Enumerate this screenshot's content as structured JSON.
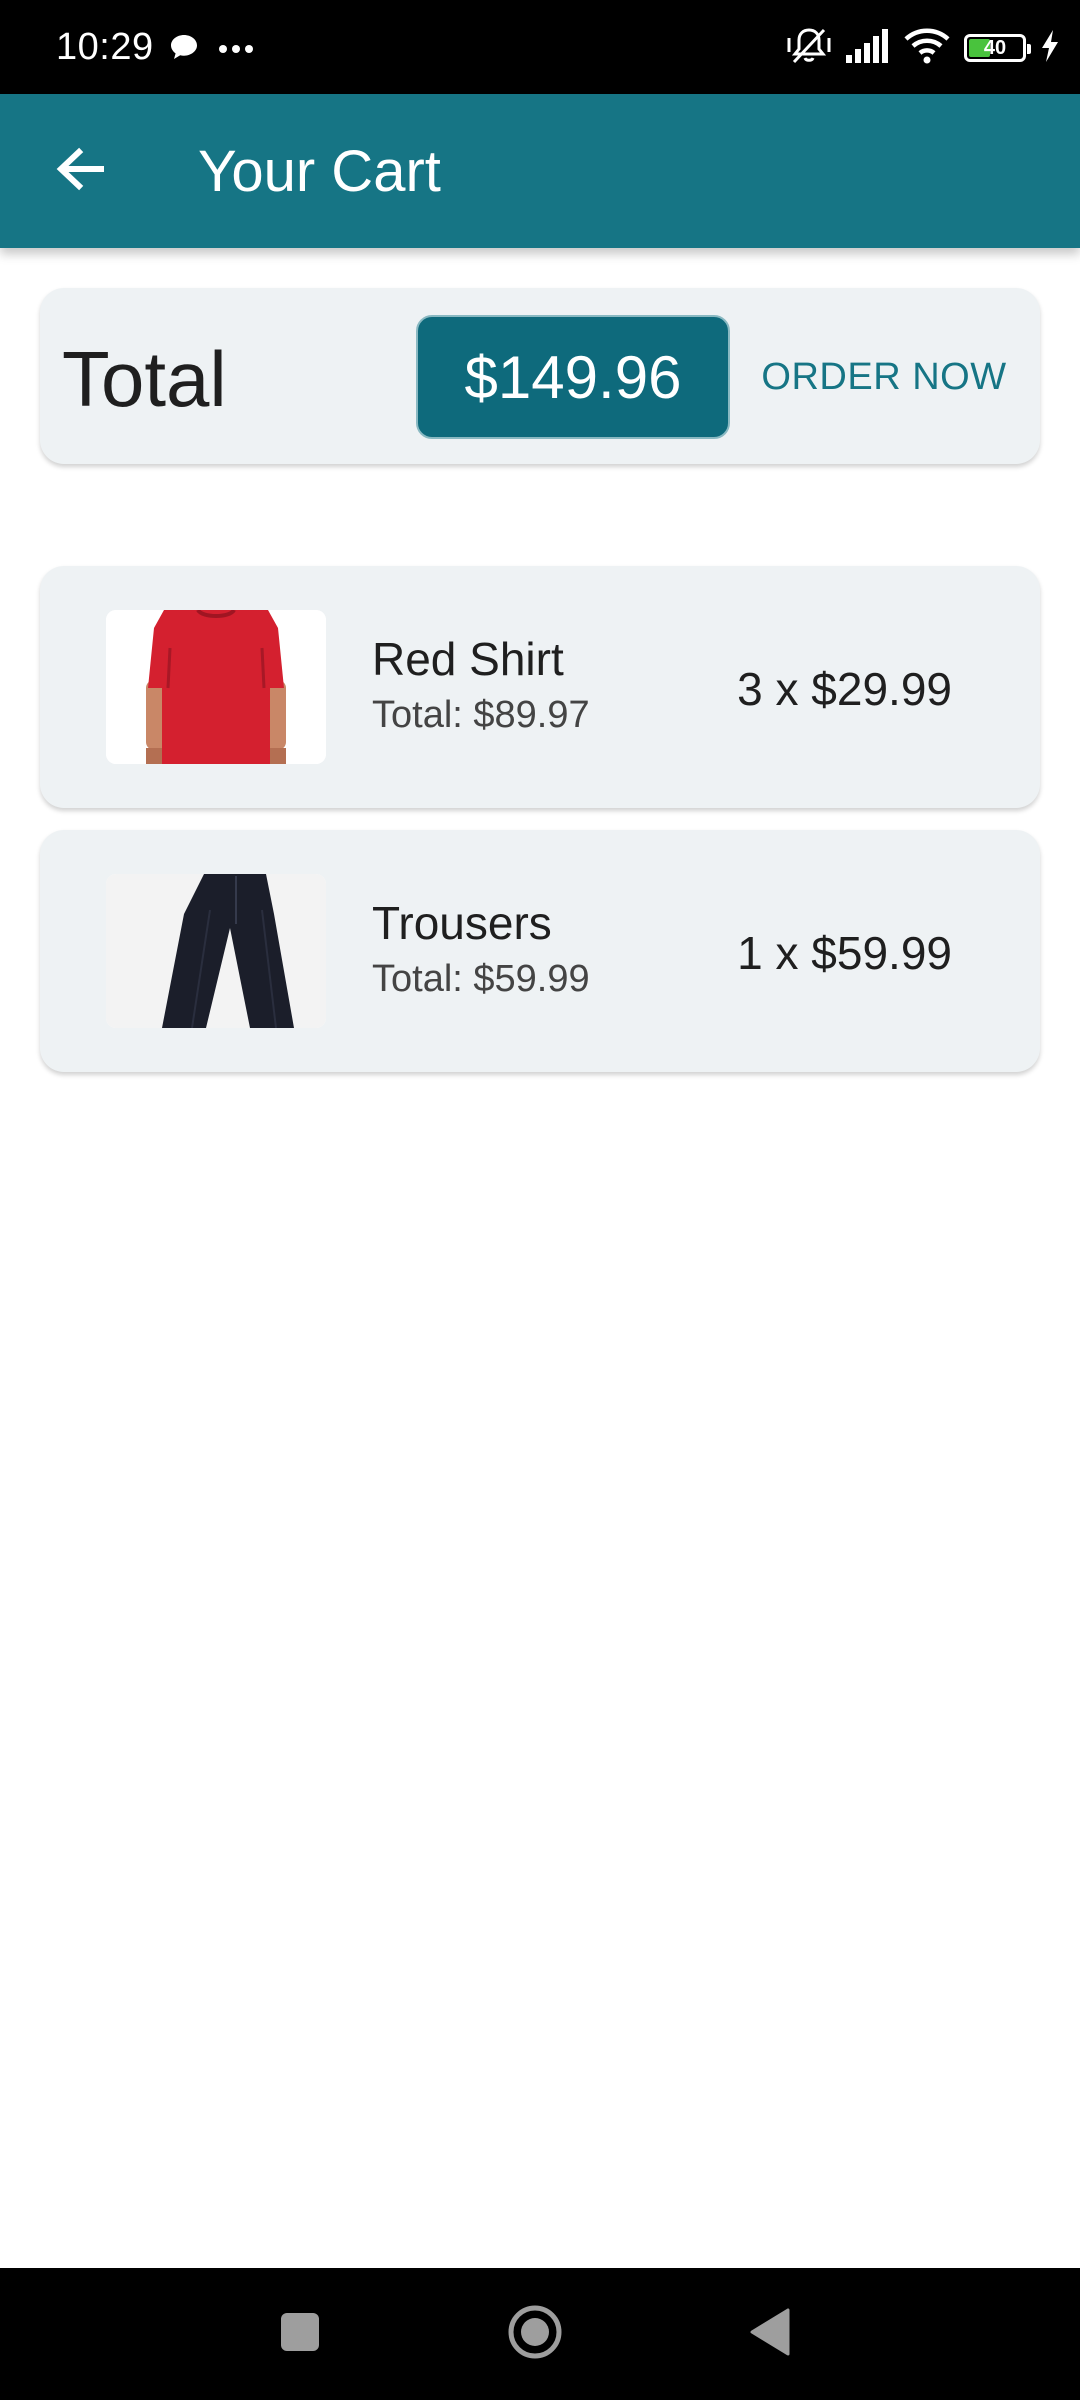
{
  "status_bar": {
    "time": "10:29",
    "left_icons": [
      "chat-bubble-icon",
      "more-dots-icon"
    ],
    "right_icons": [
      "vibrate-icon",
      "signal-icon",
      "wifi-icon",
      "battery-icon",
      "charging-bolt-icon"
    ],
    "battery_level": "40",
    "battery_fill_fraction": 0.4
  },
  "app_bar": {
    "back_icon": "arrow-left-icon",
    "title": "Your Cart",
    "color": "#167585"
  },
  "total_card": {
    "label": "Total",
    "amount": "$149.96",
    "order_label": "ORDER NOW"
  },
  "cart_items": [
    {
      "name": "Red Shirt",
      "total": "Total: $89.97",
      "quantity_price": "3 x $29.99",
      "image": "red-shirt-image"
    },
    {
      "name": "Trousers",
      "total": "Total: $59.99",
      "quantity_price": "1 x $59.99",
      "image": "trousers-image"
    }
  ],
  "nav_bar": {
    "icons": [
      "recent-apps-icon",
      "home-icon",
      "back-triangle-icon"
    ]
  }
}
